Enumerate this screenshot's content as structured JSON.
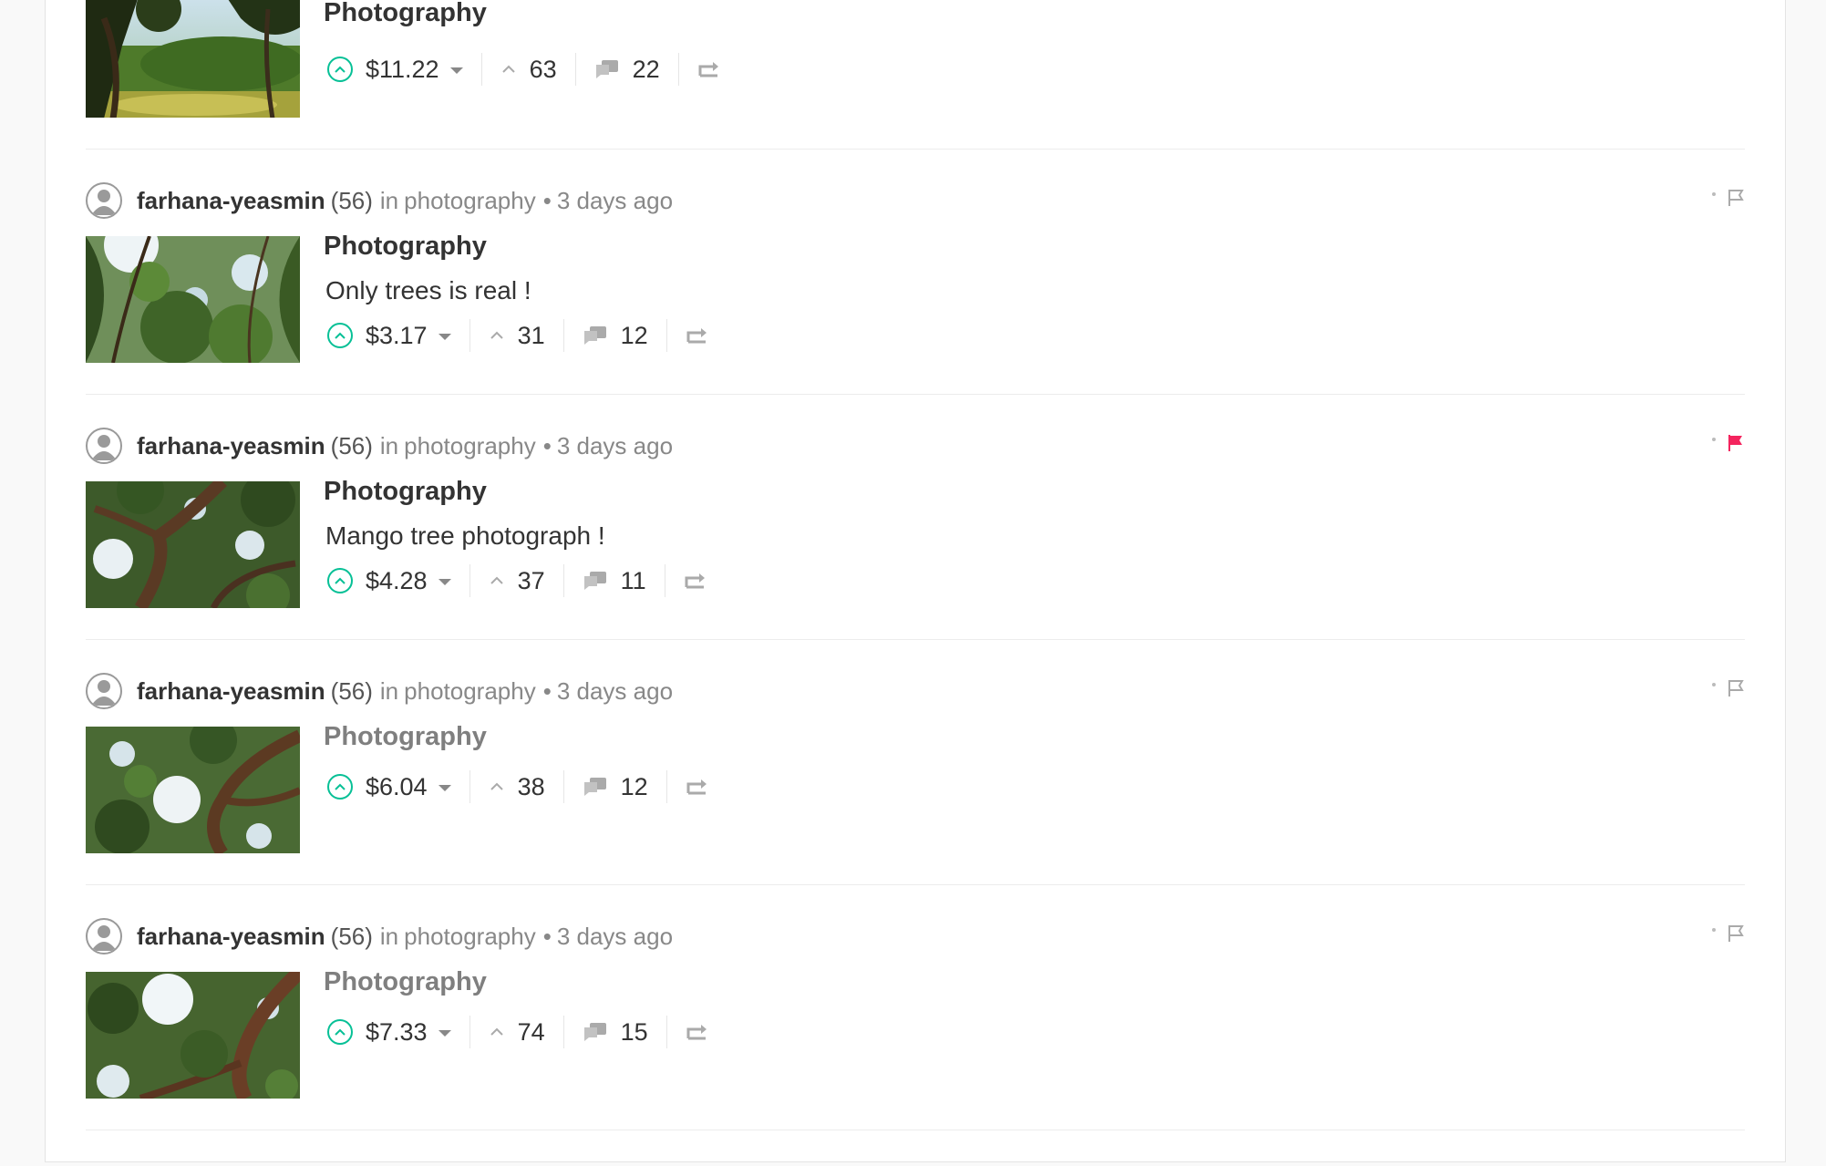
{
  "posts": [
    {
      "author": "",
      "reputation": "",
      "in_label": "",
      "category": "",
      "separator": "",
      "time": "",
      "title": "Photography",
      "title_dim": false,
      "body": "",
      "payout": "$11.22",
      "votes": "63",
      "comments": "22",
      "flagged": false,
      "thumb_scene": "park-with-trees-and-grass"
    },
    {
      "author": "farhana-yeasmin",
      "reputation": "(56)",
      "in_label": "in",
      "category": "photography",
      "separator": "•",
      "time": "3 days ago",
      "title": "Photography",
      "title_dim": false,
      "body": "Only trees is real !",
      "payout": "$3.17",
      "votes": "31",
      "comments": "12",
      "flagged": false,
      "thumb_scene": "tree-canopy-with-sunlight"
    },
    {
      "author": "farhana-yeasmin",
      "reputation": "(56)",
      "in_label": "in",
      "category": "photography",
      "separator": "•",
      "time": "3 days ago",
      "title": "Photography",
      "title_dim": false,
      "body": "Mango tree photograph !",
      "payout": "$4.28",
      "votes": "37",
      "comments": "11",
      "flagged": true,
      "thumb_scene": "mango-tree-branches"
    },
    {
      "author": "farhana-yeasmin",
      "reputation": "(56)",
      "in_label": "in",
      "category": "photography",
      "separator": "•",
      "time": "3 days ago",
      "title": "Photography",
      "title_dim": true,
      "body": "",
      "payout": "$6.04",
      "votes": "38",
      "comments": "12",
      "flagged": false,
      "thumb_scene": "tree-branches-against-sky"
    },
    {
      "author": "farhana-yeasmin",
      "reputation": "(56)",
      "in_label": "in",
      "category": "photography",
      "separator": "•",
      "time": "3 days ago",
      "title": "Photography",
      "title_dim": true,
      "body": "",
      "payout": "$7.33",
      "votes": "74",
      "comments": "15",
      "flagged": false,
      "thumb_scene": "tree-canopy-backlit"
    }
  ],
  "colors": {
    "upvote_accent": "#07c096",
    "flag_active": "#f4245e",
    "flag_inactive": "#aaaaaa",
    "icon_gray": "#aaaaaa"
  },
  "icons": {
    "upvote": "upvote-circle-icon",
    "payout_menu": "caret-down-icon",
    "votes": "chevron-up-icon",
    "comments": "comments-icon",
    "reblog": "reblog-icon",
    "flag": "flag-icon",
    "avatar": "user-avatar-icon"
  }
}
